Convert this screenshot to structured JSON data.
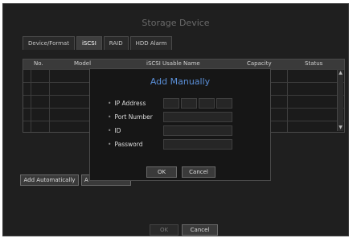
{
  "window": {
    "title": "Storage Device"
  },
  "tabs": [
    {
      "label": "Device/Format"
    },
    {
      "label": "iSCSI"
    },
    {
      "label": "RAID"
    },
    {
      "label": "HDD Alarm"
    }
  ],
  "table": {
    "columns": [
      "No.",
      "Model",
      "iSCSI Usable Name",
      "Capacity",
      "Status"
    ],
    "rows": [
      [],
      [],
      [],
      [],
      []
    ],
    "scroll_up": "▲",
    "scroll_down": "▼"
  },
  "buttons": {
    "add_automatically": "Add Automatically",
    "add_manually_partial": "A",
    "ok": "OK",
    "cancel": "Cancel"
  },
  "dialog": {
    "title": "Add Manually",
    "bullet": "•",
    "fields": {
      "ip_address": {
        "label": "IP Address",
        "value": ""
      },
      "port_number": {
        "label": "Port Number",
        "value": ""
      },
      "id": {
        "label": "ID",
        "value": ""
      },
      "password": {
        "label": "Password",
        "value": ""
      }
    },
    "ok": "OK",
    "cancel": "Cancel"
  },
  "colors": {
    "dialog_title": "#5a8fd8",
    "background": "#1f1f1f"
  }
}
